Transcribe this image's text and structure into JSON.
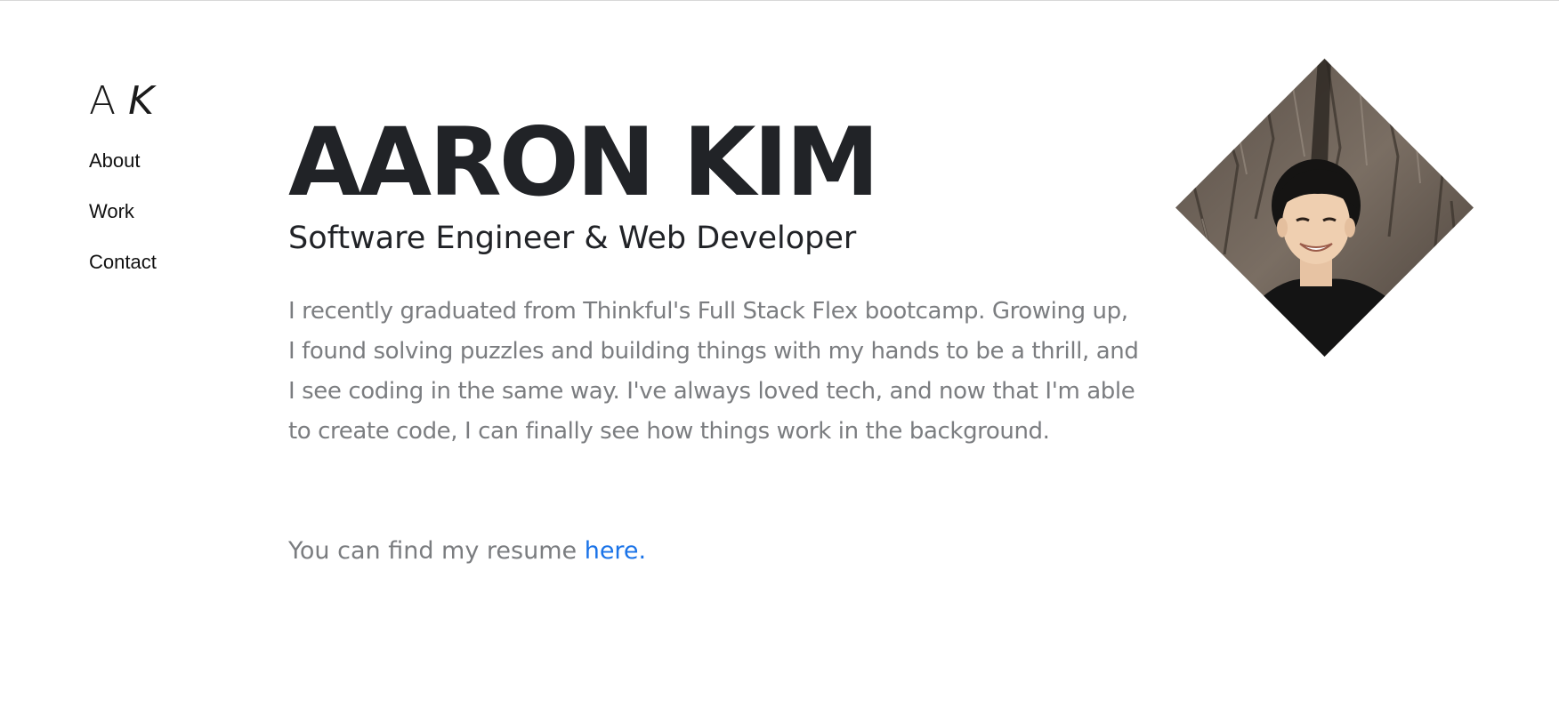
{
  "logo": {
    "first": "A",
    "second": "K"
  },
  "nav": {
    "items": [
      {
        "label": "About"
      },
      {
        "label": "Work"
      },
      {
        "label": "Contact"
      }
    ]
  },
  "hero": {
    "name": "AARON KIM",
    "subtitle": "Software Engineer & Web Developer"
  },
  "bio": {
    "lines": [
      "I recently graduated from Thinkful's Full Stack Flex bootcamp. Growing up,",
      "I found solving puzzles and building things with my hands to be a thrill, and",
      "I see coding in the same way. I've always loved tech, and now that I'm able",
      "to create code, I can finally see how things work in the background."
    ]
  },
  "resume": {
    "prefix": "You can find my resume ",
    "link_label": "here."
  },
  "colors": {
    "heading": "#212327",
    "body_text": "#7b7d80",
    "link": "#1a73e8"
  }
}
